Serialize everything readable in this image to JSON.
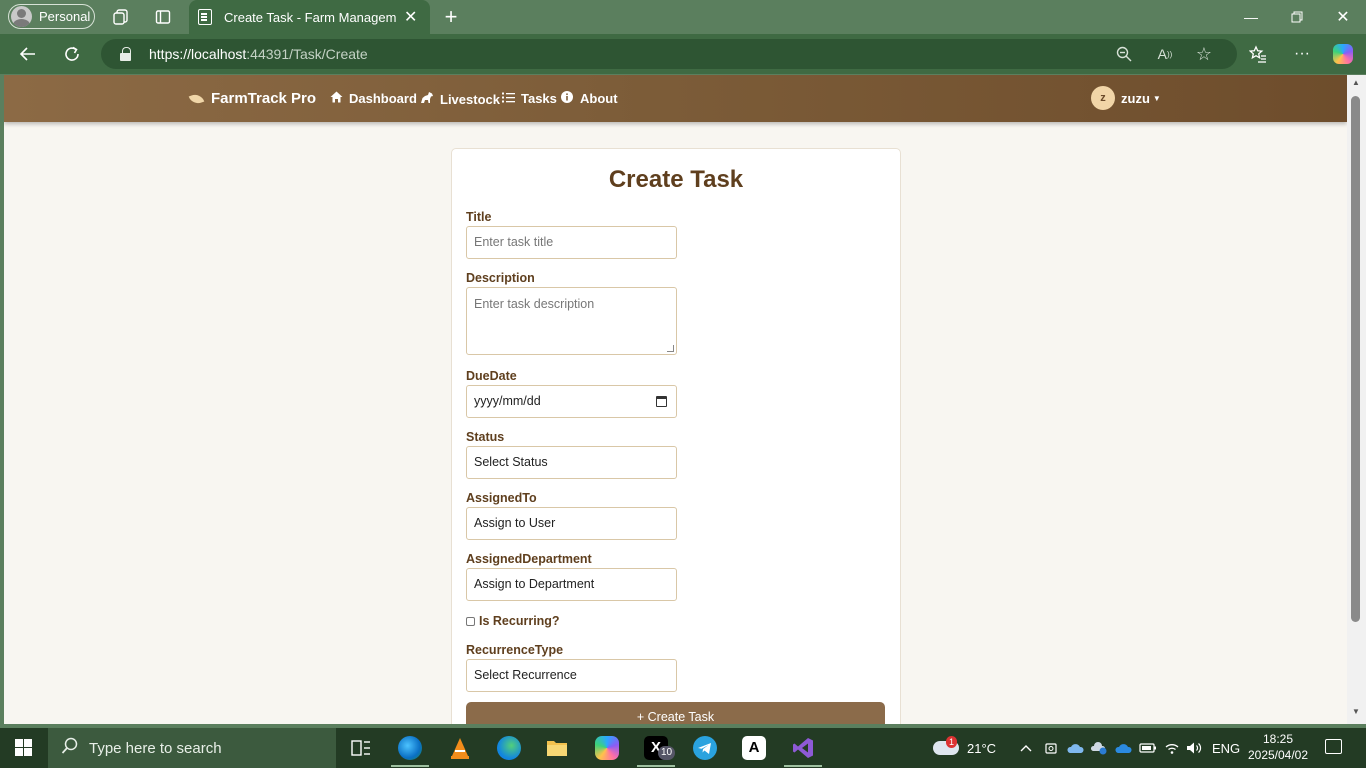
{
  "browser": {
    "profile_label": "Personal",
    "tab_title": "Create Task - Farm Management S",
    "url_host": "https://localhost",
    "url_rest": ":44391/Task/Create"
  },
  "app": {
    "brand": "FarmTrack Pro",
    "nav": [
      {
        "label": "Dashboard",
        "icon": "home-icon"
      },
      {
        "label": "Livestock",
        "icon": "horse-icon"
      },
      {
        "label": "Tasks",
        "icon": "list-icon"
      },
      {
        "label": "About",
        "icon": "info-icon"
      }
    ],
    "user_initial": "z",
    "user_name": "zuzu"
  },
  "form": {
    "heading": "Create Task",
    "title_label": "Title",
    "title_placeholder": "Enter task title",
    "description_label": "Description",
    "description_placeholder": "Enter task description",
    "duedate_label": "DueDate",
    "duedate_placeholder": "yyyy/mm/dd",
    "status_label": "Status",
    "status_value": "Select Status",
    "assignedto_label": "AssignedTo",
    "assignedto_value": "Assign to User",
    "department_label": "AssignedDepartment",
    "department_value": "Assign to Department",
    "recurring_label": "Is Recurring?",
    "recurrence_label": "RecurrenceType",
    "recurrence_value": "Select Recurrence",
    "submit_label": "Create Task"
  },
  "taskbar": {
    "search_placeholder": "Type here to search",
    "weather_temp": "21°C",
    "language": "ENG",
    "time": "18:25",
    "date": "2025/04/02",
    "x_badge": "10",
    "weather_badge": "1"
  },
  "colors": {
    "nav_brown": "#7d5d39",
    "heading_brown": "#5f3f1e",
    "button_brown": "#8b6b4a",
    "browser_green": "#3f6a43"
  }
}
